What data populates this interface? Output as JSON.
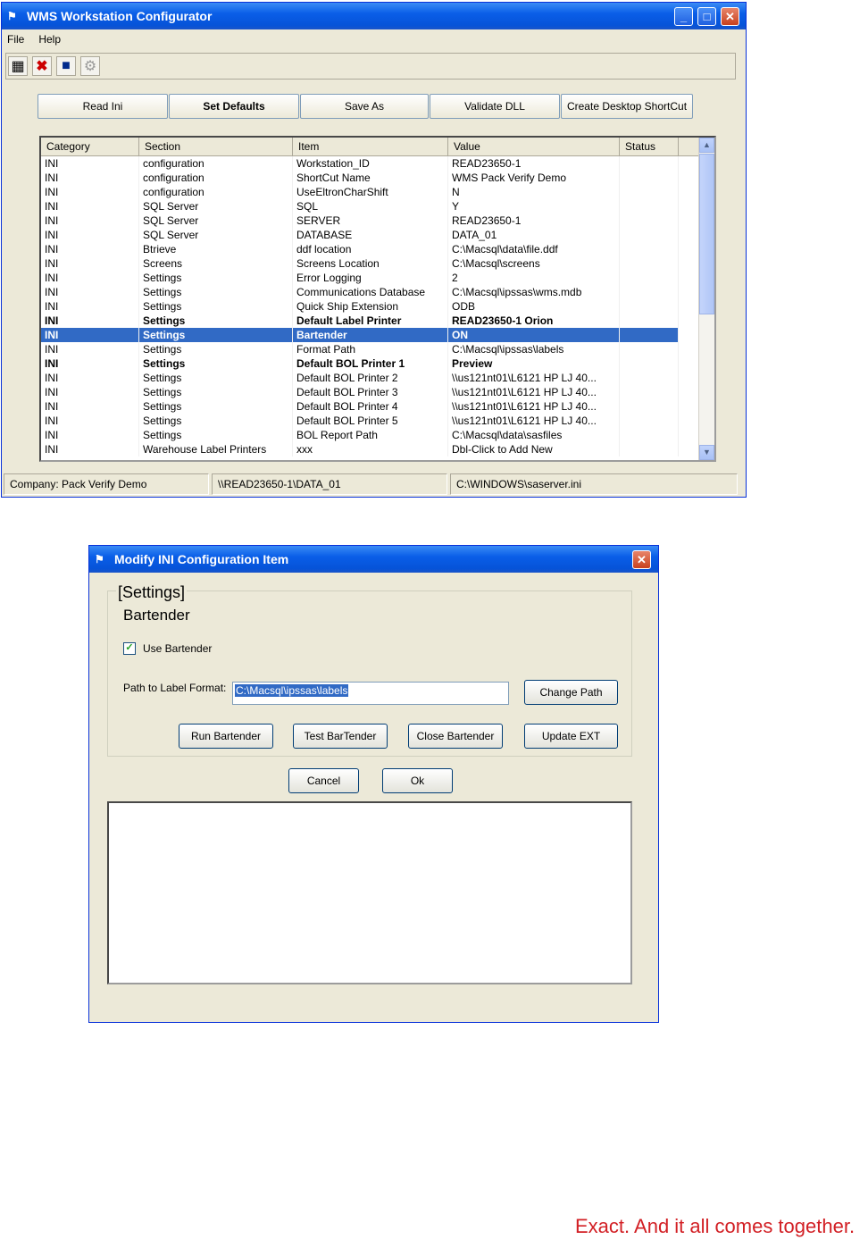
{
  "main_window": {
    "title": "WMS Workstation Configurator",
    "menu": [
      "File",
      "Help"
    ],
    "toolbar_icons": [
      "grid-icon",
      "delete-x-icon",
      "save-disk-icon",
      "gear-icon"
    ],
    "buttons": [
      "Read Ini",
      "Set Defaults",
      "Save As",
      "Validate DLL",
      "Create Desktop ShortCut"
    ],
    "grid_columns": [
      "Category",
      "Section",
      "Item",
      "Value",
      "Status"
    ],
    "rows": [
      {
        "category": "INI",
        "section": "configuration",
        "item": "Workstation_ID",
        "value": "READ23650-1",
        "status": "",
        "style": "normal"
      },
      {
        "category": "INI",
        "section": "configuration",
        "item": "ShortCut Name",
        "value": "WMS Pack Verify Demo",
        "status": "",
        "style": "normal"
      },
      {
        "category": "INI",
        "section": "configuration",
        "item": "UseEltronCharShift",
        "value": "N",
        "status": "",
        "style": "normal"
      },
      {
        "category": "INI",
        "section": "SQL Server",
        "item": "SQL",
        "value": "Y",
        "status": "",
        "style": "normal"
      },
      {
        "category": "INI",
        "section": "SQL Server",
        "item": "SERVER",
        "value": "READ23650-1",
        "status": "",
        "style": "normal"
      },
      {
        "category": "INI",
        "section": "SQL Server",
        "item": "DATABASE",
        "value": "DATA_01",
        "status": "",
        "style": "normal"
      },
      {
        "category": "INI",
        "section": "Btrieve",
        "item": "ddf location",
        "value": "C:\\Macsql\\data\\file.ddf",
        "status": "",
        "style": "normal"
      },
      {
        "category": "INI",
        "section": "Screens",
        "item": "Screens Location",
        "value": "C:\\Macsql\\screens",
        "status": "",
        "style": "normal"
      },
      {
        "category": "INI",
        "section": "Settings",
        "item": "Error Logging",
        "value": "2",
        "status": "",
        "style": "normal"
      },
      {
        "category": "INI",
        "section": "Settings",
        "item": "Communications Database",
        "value": "C:\\Macsql\\ipssas\\wms.mdb",
        "status": "",
        "style": "normal"
      },
      {
        "category": "INI",
        "section": "Settings",
        "item": "Quick Ship Extension",
        "value": "ODB",
        "status": "",
        "style": "normal"
      },
      {
        "category": "INI",
        "section": "Settings",
        "item": "Default Label Printer",
        "value": "READ23650-1 Orion",
        "status": "",
        "style": "bold"
      },
      {
        "category": "INI",
        "section": "Settings",
        "item": "Bartender",
        "value": "ON",
        "status": "",
        "style": "selected"
      },
      {
        "category": "INI",
        "section": "Settings",
        "item": "Format Path",
        "value": "C:\\Macsql\\ipssas\\labels",
        "status": "",
        "style": "normal"
      },
      {
        "category": "INI",
        "section": "Settings",
        "item": "Default BOL Printer 1",
        "value": "Preview",
        "status": "",
        "style": "bold"
      },
      {
        "category": "INI",
        "section": "Settings",
        "item": "Default BOL Printer 2",
        "value": "\\\\us121nt01\\L6121 HP LJ 40...",
        "status": "",
        "style": "normal"
      },
      {
        "category": "INI",
        "section": "Settings",
        "item": "Default BOL Printer 3",
        "value": "\\\\us121nt01\\L6121 HP LJ 40...",
        "status": "",
        "style": "normal"
      },
      {
        "category": "INI",
        "section": "Settings",
        "item": "Default BOL Printer 4",
        "value": "\\\\us121nt01\\L6121 HP LJ 40...",
        "status": "",
        "style": "normal"
      },
      {
        "category": "INI",
        "section": "Settings",
        "item": "Default BOL Printer 5",
        "value": "\\\\us121nt01\\L6121 HP LJ 40...",
        "status": "",
        "style": "normal"
      },
      {
        "category": "INI",
        "section": "Settings",
        "item": "BOL Report Path",
        "value": "C:\\Macsql\\data\\sasfiles",
        "status": "",
        "style": "normal"
      },
      {
        "category": "INI",
        "section": "Warehouse Label Printers",
        "item": "xxx",
        "value": "Dbl-Click to Add New",
        "status": "",
        "style": "normal"
      }
    ],
    "status": [
      "Company: Pack Verify Demo",
      "\\\\READ23650-1\\DATA_01",
      "C:\\WINDOWS\\saserver.ini"
    ]
  },
  "dialog": {
    "title": "Modify INI Configuration Item",
    "section": "[Settings]",
    "item": "Bartender",
    "checkbox_label": "Use Bartender",
    "checkbox_checked": true,
    "path_label": "Path to Label Format:",
    "path_value": "C:\\Macsql\\ipssas\\labels",
    "change_path": "Change Path",
    "run_bartender": "Run Bartender",
    "test_bartender": "Test BarTender",
    "close_bartender": "Close Bartender",
    "update_ext": "Update EXT",
    "cancel": "Cancel",
    "ok": "Ok"
  },
  "slogan": "Exact. And it all comes together."
}
